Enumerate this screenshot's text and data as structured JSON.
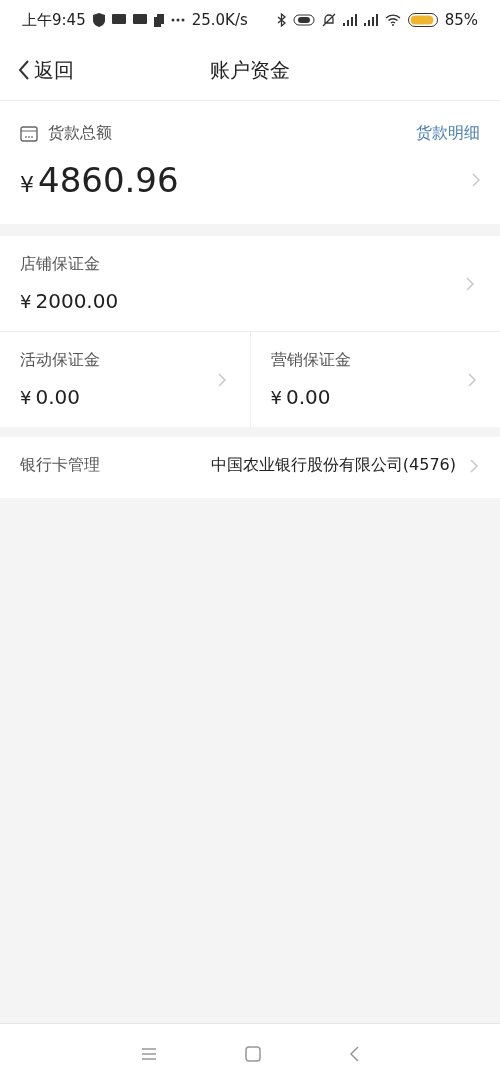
{
  "status_bar": {
    "time": "上午9:45",
    "net_speed": "25.0K/s",
    "battery": "85%"
  },
  "nav": {
    "back": "返回",
    "title": "账户资金"
  },
  "payment": {
    "label": "货款总额",
    "link": "货款明细",
    "currency": "¥",
    "amount": "4860.96"
  },
  "deposits": [
    {
      "label": "店铺保证金",
      "currency": "¥",
      "amount": "2000.00"
    },
    {
      "label": "活动保证金",
      "currency": "¥",
      "amount": "0.00"
    },
    {
      "label": "营销保证金",
      "currency": "¥",
      "amount": "0.00"
    }
  ],
  "bank": {
    "label": "银行卡管理",
    "value": "中国农业银行股份有限公司(4576)"
  }
}
